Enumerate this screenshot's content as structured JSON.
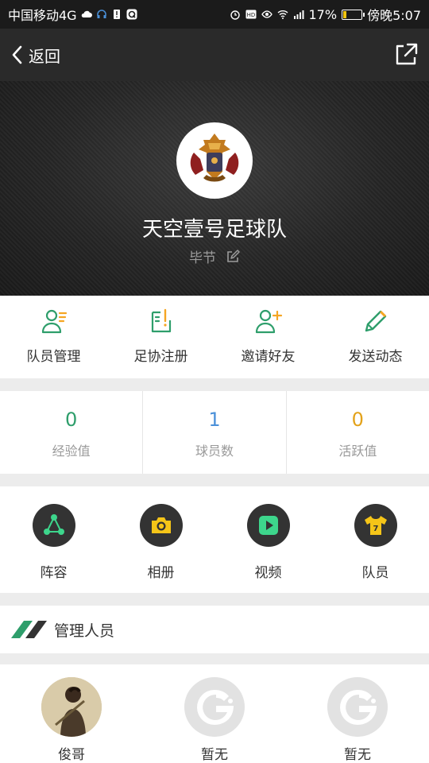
{
  "status_bar": {
    "carrier": "中国移动4G",
    "battery": "17%",
    "battery_level": 0.17,
    "time": "傍晚5:07"
  },
  "nav": {
    "back_label": "返回"
  },
  "team": {
    "name": "天空壹号足球队",
    "city": "毕节"
  },
  "actions": [
    {
      "label": "队员管理",
      "icon": "member-manage-icon"
    },
    {
      "label": "足协注册",
      "icon": "register-icon"
    },
    {
      "label": "邀请好友",
      "icon": "invite-friend-icon"
    },
    {
      "label": "发送动态",
      "icon": "pencil-icon"
    }
  ],
  "stats": [
    {
      "value": "0",
      "label": "经验值",
      "color": "#2e9e6b"
    },
    {
      "value": "1",
      "label": "球员数",
      "color": "#4a90d9"
    },
    {
      "value": "0",
      "label": "活跃值",
      "color": "#e3a21a"
    }
  ],
  "features": [
    {
      "label": "阵容",
      "icon": "formation-icon",
      "color": "#3dd68c"
    },
    {
      "label": "相册",
      "icon": "camera-icon",
      "color": "#f5c518"
    },
    {
      "label": "视频",
      "icon": "video-play-icon",
      "color": "#3dd68c"
    },
    {
      "label": "队员",
      "icon": "jersey-icon",
      "color": "#f5c518",
      "jersey_number": "7"
    }
  ],
  "managers_section": {
    "title": "管理人员"
  },
  "managers": [
    {
      "name": "俊哥"
    },
    {
      "name": "暂无"
    },
    {
      "name": "暂无"
    }
  ],
  "colors": {
    "accent_green": "#2e9e6b",
    "nav_bg": "#2a2a2a",
    "status_bg": "#1b1b1b"
  }
}
